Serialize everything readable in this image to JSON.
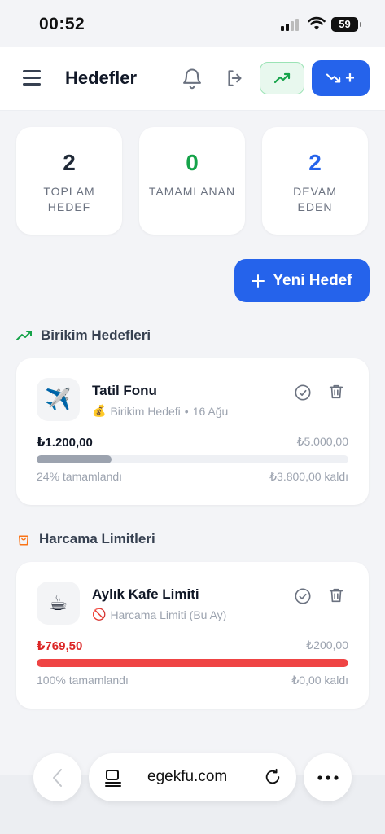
{
  "status_bar": {
    "time": "00:52",
    "battery": "59"
  },
  "header": {
    "title": "Hedefler",
    "add_label": "+"
  },
  "stats": [
    {
      "value": "2",
      "label": "TOPLAM HEDEF",
      "color": "#1f2937"
    },
    {
      "value": "0",
      "label": "TAMAMLANAN",
      "color": "#16a34a"
    },
    {
      "value": "2",
      "label": "DEVAM EDEN",
      "color": "#2563eb"
    }
  ],
  "new_goal_button": {
    "label": "Yeni Hedef",
    "icon": "plus-icon"
  },
  "sections": {
    "savings": {
      "title": "Birikim Hedefleri",
      "icon": "trend-up-icon",
      "goal": {
        "emoji": "✈️",
        "name": "Tatil Fonu",
        "type_emoji": "💰",
        "type": "Birikim Hedefi",
        "separator": "•",
        "date": "16 Ağu",
        "current": "₺1.200,00",
        "target": "₺5.000,00",
        "progress": 0.24,
        "bar_color": "#9ca3af",
        "percent_text": "24% tamamlandı",
        "remaining": "₺3.800,00 kaldı"
      }
    },
    "spending": {
      "title": "Harcama Limitleri",
      "icon": "shopping-bag-icon",
      "goal": {
        "emoji": "☕",
        "name": "Aylık Kafe Limiti",
        "type_emoji": "🚫",
        "type": "Harcama Limiti (Bu Ay)",
        "current": "₺769,50",
        "target": "₺200,00",
        "progress": 1.0,
        "bar_color": "#ef4444",
        "current_color": "#dc2626",
        "percent_text": "100% tamamlandı",
        "remaining": "₺0,00 kaldı"
      }
    }
  },
  "browser": {
    "url": "egekfu.com"
  }
}
